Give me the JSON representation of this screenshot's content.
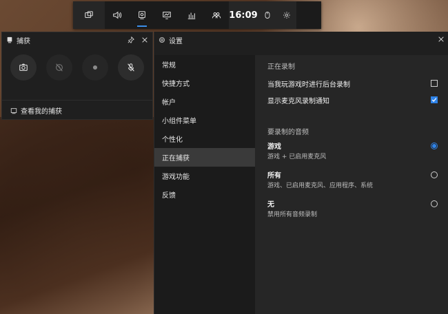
{
  "gamebar": {
    "time": "16:09",
    "icons": [
      "widget-menu-icon",
      "audio-icon",
      "capture-icon",
      "performance-icon",
      "resources-icon",
      "social-icon"
    ],
    "active": "capture-icon"
  },
  "capture": {
    "title": "捕获",
    "show_all": "查看我的捕获"
  },
  "settings": {
    "title": "设置",
    "nav": [
      "常规",
      "快捷方式",
      "帐户",
      "小组件菜单",
      "个性化",
      "正在捕获",
      "游戏功能",
      "反馈"
    ],
    "selected_nav": "正在捕获",
    "recording_title": "正在录制",
    "background_record": "当我玩游戏时进行后台录制",
    "background_checked": false,
    "mic_notify": "显示麦克风录制通知",
    "mic_checked": true,
    "audio_title": "要录制的音频",
    "audio_options": [
      {
        "name": "游戏",
        "desc": "游戏 + 已启用麦克风",
        "selected": true
      },
      {
        "name": "所有",
        "desc": "游戏、已启用麦克风、应用程序、系统",
        "selected": false
      },
      {
        "name": "无",
        "desc": "禁用所有音频录制",
        "selected": false
      }
    ]
  },
  "colors": {
    "accent": "#2f83e8",
    "panel": "#1f1f1f",
    "content": "#262626"
  }
}
